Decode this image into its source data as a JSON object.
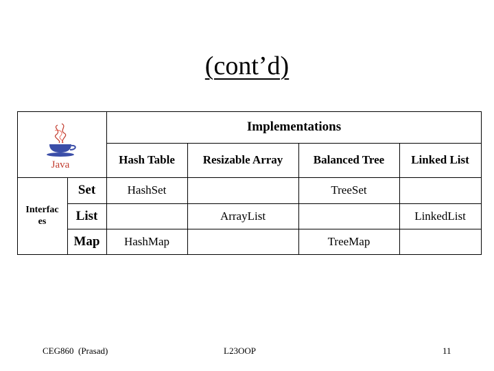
{
  "slide": {
    "title": "(cont’d)",
    "table": {
      "header_group": "Implementations",
      "logo_label": "Java",
      "columns": [
        "Hash Table",
        "Resizable Array",
        "Balanced Tree",
        "Linked List"
      ],
      "row_group": "Interfac es",
      "rows": [
        {
          "name": "Set",
          "cells": [
            "HashSet",
            "",
            "TreeSet",
            ""
          ]
        },
        {
          "name": "List",
          "cells": [
            "",
            "ArrayList",
            "",
            "LinkedList"
          ]
        },
        {
          "name": "Map",
          "cells": [
            "HashMap",
            "",
            "TreeMap",
            ""
          ]
        }
      ]
    },
    "footer": {
      "left": "CEG860  (Prasad)",
      "center": "L23OOP",
      "page_number": "11"
    }
  }
}
